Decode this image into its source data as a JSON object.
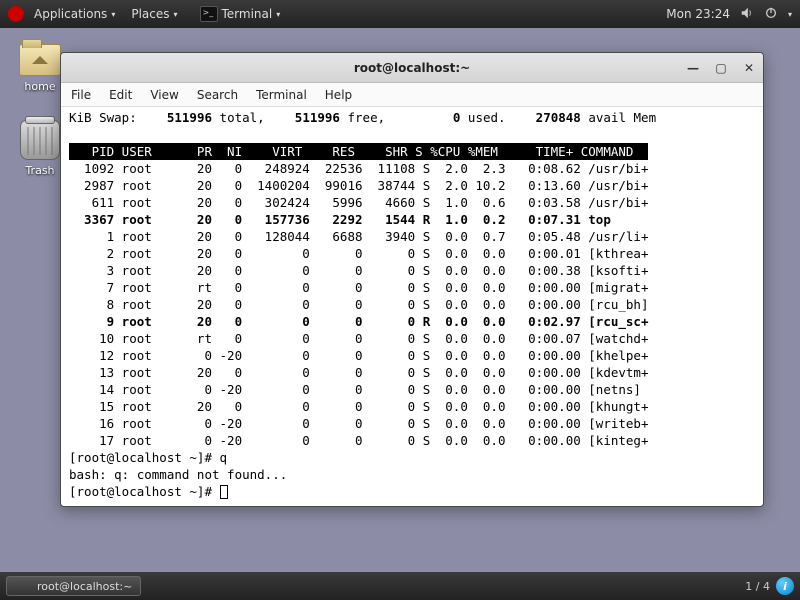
{
  "topbar": {
    "applications": "Applications",
    "places": "Places",
    "terminal": "Terminal",
    "clock": "Mon 23:24"
  },
  "desktop": {
    "home": "home",
    "trash": "Trash"
  },
  "window": {
    "title": "root@localhost:~",
    "menubar": [
      "File",
      "Edit",
      "View",
      "Search",
      "Terminal",
      "Help"
    ]
  },
  "swap_line": {
    "label": "KiB Swap:",
    "total_val": "511996",
    "total_lbl": "total,",
    "free_val": "511996",
    "free_lbl": "free,",
    "used_val": "0",
    "used_lbl": "used.",
    "avail_val": "270848",
    "avail_lbl": "avail Mem"
  },
  "top_header": "   PID USER      PR  NI    VIRT    RES    SHR S %CPU %MEM     TIME+ COMMAND  ",
  "rows": [
    {
      "pid": "1092",
      "user": "root",
      "pr": "20",
      "ni": "0",
      "virt": "248924",
      "res": "22536",
      "shr": "11108",
      "s": "S",
      "cpu": "2.0",
      "mem": "2.3",
      "time": "0:08.62",
      "cmd": "/usr/bi+",
      "bold": false
    },
    {
      "pid": "2987",
      "user": "root",
      "pr": "20",
      "ni": "0",
      "virt": "1400204",
      "res": "99016",
      "shr": "38744",
      "s": "S",
      "cpu": "2.0",
      "mem": "10.2",
      "time": "0:13.60",
      "cmd": "/usr/bi+",
      "bold": false
    },
    {
      "pid": "611",
      "user": "root",
      "pr": "20",
      "ni": "0",
      "virt": "302424",
      "res": "5996",
      "shr": "4660",
      "s": "S",
      "cpu": "1.0",
      "mem": "0.6",
      "time": "0:03.58",
      "cmd": "/usr/bi+",
      "bold": false
    },
    {
      "pid": "3367",
      "user": "root",
      "pr": "20",
      "ni": "0",
      "virt": "157736",
      "res": "2292",
      "shr": "1544",
      "s": "R",
      "cpu": "1.0",
      "mem": "0.2",
      "time": "0:07.31",
      "cmd": "top",
      "bold": true
    },
    {
      "pid": "1",
      "user": "root",
      "pr": "20",
      "ni": "0",
      "virt": "128044",
      "res": "6688",
      "shr": "3940",
      "s": "S",
      "cpu": "0.0",
      "mem": "0.7",
      "time": "0:05.48",
      "cmd": "/usr/li+",
      "bold": false
    },
    {
      "pid": "2",
      "user": "root",
      "pr": "20",
      "ni": "0",
      "virt": "0",
      "res": "0",
      "shr": "0",
      "s": "S",
      "cpu": "0.0",
      "mem": "0.0",
      "time": "0:00.01",
      "cmd": "[kthrea+",
      "bold": false
    },
    {
      "pid": "3",
      "user": "root",
      "pr": "20",
      "ni": "0",
      "virt": "0",
      "res": "0",
      "shr": "0",
      "s": "S",
      "cpu": "0.0",
      "mem": "0.0",
      "time": "0:00.38",
      "cmd": "[ksofti+",
      "bold": false
    },
    {
      "pid": "7",
      "user": "root",
      "pr": "rt",
      "ni": "0",
      "virt": "0",
      "res": "0",
      "shr": "0",
      "s": "S",
      "cpu": "0.0",
      "mem": "0.0",
      "time": "0:00.00",
      "cmd": "[migrat+",
      "bold": false
    },
    {
      "pid": "8",
      "user": "root",
      "pr": "20",
      "ni": "0",
      "virt": "0",
      "res": "0",
      "shr": "0",
      "s": "S",
      "cpu": "0.0",
      "mem": "0.0",
      "time": "0:00.00",
      "cmd": "[rcu_bh]",
      "bold": false
    },
    {
      "pid": "9",
      "user": "root",
      "pr": "20",
      "ni": "0",
      "virt": "0",
      "res": "0",
      "shr": "0",
      "s": "R",
      "cpu": "0.0",
      "mem": "0.0",
      "time": "0:02.97",
      "cmd": "[rcu_sc+",
      "bold": true
    },
    {
      "pid": "10",
      "user": "root",
      "pr": "rt",
      "ni": "0",
      "virt": "0",
      "res": "0",
      "shr": "0",
      "s": "S",
      "cpu": "0.0",
      "mem": "0.0",
      "time": "0:00.07",
      "cmd": "[watchd+",
      "bold": false
    },
    {
      "pid": "12",
      "user": "root",
      "pr": "0",
      "ni": "-20",
      "virt": "0",
      "res": "0",
      "shr": "0",
      "s": "S",
      "cpu": "0.0",
      "mem": "0.0",
      "time": "0:00.00",
      "cmd": "[khelpe+",
      "bold": false
    },
    {
      "pid": "13",
      "user": "root",
      "pr": "20",
      "ni": "0",
      "virt": "0",
      "res": "0",
      "shr": "0",
      "s": "S",
      "cpu": "0.0",
      "mem": "0.0",
      "time": "0:00.00",
      "cmd": "[kdevtm+",
      "bold": false
    },
    {
      "pid": "14",
      "user": "root",
      "pr": "0",
      "ni": "-20",
      "virt": "0",
      "res": "0",
      "shr": "0",
      "s": "S",
      "cpu": "0.0",
      "mem": "0.0",
      "time": "0:00.00",
      "cmd": "[netns]",
      "bold": false
    },
    {
      "pid": "15",
      "user": "root",
      "pr": "20",
      "ni": "0",
      "virt": "0",
      "res": "0",
      "shr": "0",
      "s": "S",
      "cpu": "0.0",
      "mem": "0.0",
      "time": "0:00.00",
      "cmd": "[khungt+",
      "bold": false
    },
    {
      "pid": "16",
      "user": "root",
      "pr": "0",
      "ni": "-20",
      "virt": "0",
      "res": "0",
      "shr": "0",
      "s": "S",
      "cpu": "0.0",
      "mem": "0.0",
      "time": "0:00.00",
      "cmd": "[writeb+",
      "bold": false
    },
    {
      "pid": "17",
      "user": "root",
      "pr": "0",
      "ni": "-20",
      "virt": "0",
      "res": "0",
      "shr": "0",
      "s": "S",
      "cpu": "0.0",
      "mem": "0.0",
      "time": "0:00.00",
      "cmd": "[kinteg+",
      "bold": false
    }
  ],
  "shell": {
    "prompt1": "[root@localhost ~]# q",
    "error": "bash: q: command not found...",
    "prompt2": "[root@localhost ~]# "
  },
  "bottombar": {
    "task": "root@localhost:~",
    "workspace": "1 / 4"
  }
}
